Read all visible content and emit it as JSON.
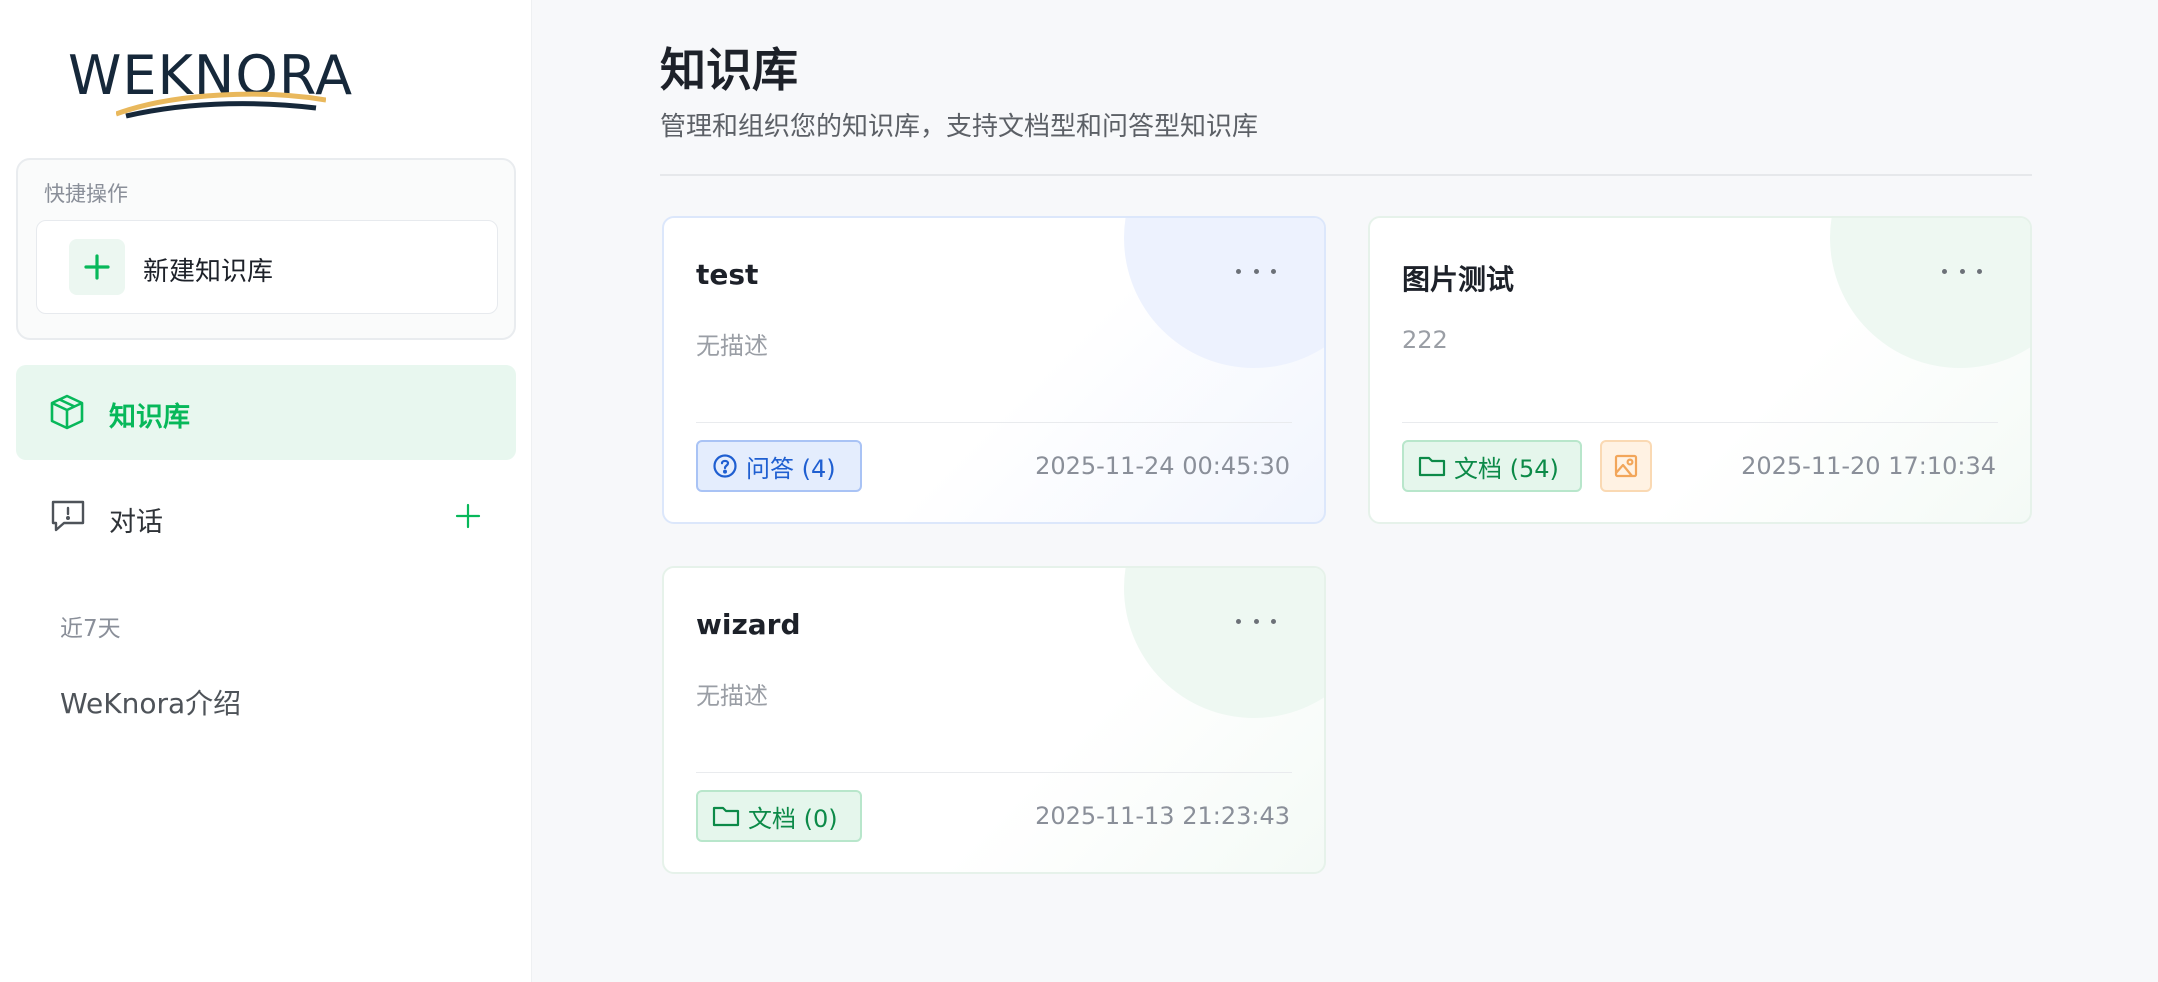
{
  "sidebar": {
    "logo_text": "WEKNORA",
    "quick_actions": {
      "title": "快捷操作",
      "new_kb_label": "新建知识库"
    },
    "nav": {
      "knowledge_base": "知识库",
      "chat": "对话"
    },
    "recent": {
      "label": "近7天",
      "items": [
        "WeKnora介绍"
      ]
    }
  },
  "main": {
    "title": "知识库",
    "subtitle": "管理和组织您的知识库，支持文档型和问答型知识库",
    "cards": [
      {
        "name": "test",
        "description": "无描述",
        "tag_label": "问答 (4)",
        "tag_type": "qa",
        "time": "2025-11-24 00:45:30"
      },
      {
        "name": "图片测试",
        "description": "222",
        "tag_label": "文档 (54)",
        "tag_type": "doc",
        "has_image_tag": true,
        "time": "2025-11-20 17:10:34"
      },
      {
        "name": "wizard",
        "description": "无描述",
        "tag_label": "文档 (0)",
        "tag_type": "doc",
        "time": "2025-11-13 21:23:43"
      }
    ]
  },
  "colors": {
    "accent_green": "#07b85a",
    "qa_blue": "#1f5fd1",
    "image_orange": "#f2a65a"
  }
}
